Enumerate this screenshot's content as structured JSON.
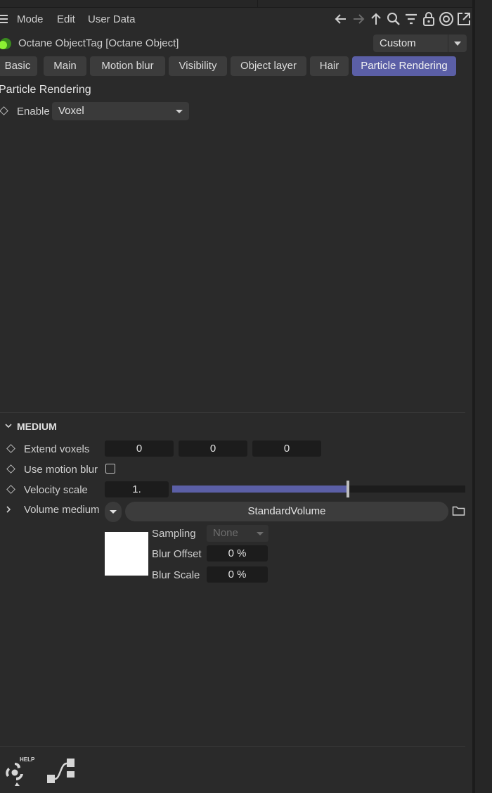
{
  "menu": {
    "mode": "Mode",
    "edit": "Edit",
    "user_data": "User Data"
  },
  "toolbar": {
    "icons": [
      "arrow-left-icon",
      "arrow-right-icon",
      "arrow-up-icon",
      "search-icon",
      "filter-icon",
      "lock-icon",
      "target-icon",
      "external-window-icon"
    ]
  },
  "object": {
    "title": "Octane ObjectTag [Octane Object]",
    "preset": "Custom"
  },
  "tabs": [
    {
      "label": "Basic"
    },
    {
      "label": "Main"
    },
    {
      "label": "Motion blur"
    },
    {
      "label": "Visibility"
    },
    {
      "label": "Object layer"
    },
    {
      "label": "Hair"
    },
    {
      "label": "Particle Rendering",
      "active": true
    }
  ],
  "particle": {
    "title": "Particle Rendering",
    "enable_label": "Enable",
    "enable_value": "Voxel"
  },
  "medium": {
    "header": "MEDIUM",
    "extend_voxels_label": "Extend voxels",
    "extend_voxels": [
      "0",
      "0",
      "0"
    ],
    "use_motion_blur_label": "Use motion blur",
    "use_motion_blur": false,
    "velocity_scale_label": "Velocity scale",
    "velocity_scale": "1.",
    "velocity_scale_fraction": 0.6,
    "volume_medium_label": "Volume medium",
    "volume_medium_value": "StandardVolume",
    "sampling_label": "Sampling",
    "sampling_value": "None",
    "blur_offset_label": "Blur Offset",
    "blur_offset_value": "0 %",
    "blur_scale_label": "Blur Scale",
    "blur_scale_value": "0 %",
    "swatch_color": "#ffffff"
  },
  "colors": {
    "accent": "#5b5fa6",
    "background": "#2a2a2a",
    "field": "#1c1c1c"
  },
  "footer": {
    "help_label": "HELP"
  }
}
